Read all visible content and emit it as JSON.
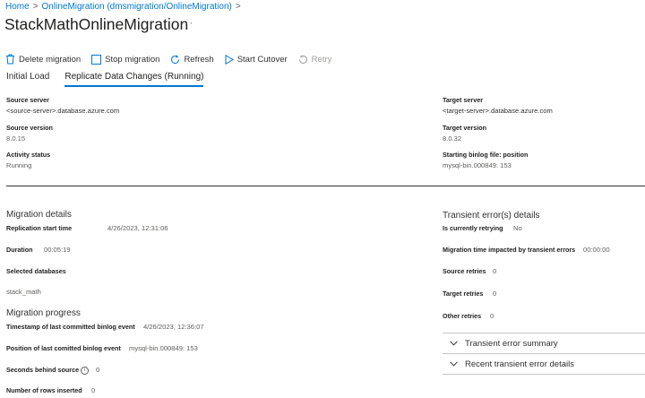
{
  "breadcrumb": {
    "home": "Home",
    "parent": "OnlineMigration (dmsmigration/OnlineMigration)",
    "sep": ">"
  },
  "page": {
    "title": "StackMathOnlineMigration",
    "more": "···"
  },
  "toolbar": {
    "delete_label": "Delete migration",
    "stop_label": "Stop migration",
    "refresh_label": "Refresh",
    "cutover_label": "Start Cutover",
    "retry_label": "Retry"
  },
  "tabs": [
    {
      "label": "Initial Load"
    },
    {
      "label": "Replicate Data Changes (Running)"
    }
  ],
  "source": {
    "server_label": "Source server",
    "server_value": "<source-server>.database.azure.com",
    "version_label": "Source version",
    "version_value": "8.0.15",
    "status_label": "Activity status",
    "status_value": "Running"
  },
  "target": {
    "server_label": "Target server",
    "server_value": "<target-server>.database.azure.com",
    "version_label": "Target version",
    "version_value": "8.0.32",
    "binlog_label": "Starting binlog file: position",
    "binlog_value": "mysql-bin.000849: 153"
  },
  "migration_details": {
    "heading": "Migration details",
    "start_label": "Replication start time",
    "start_value": "4/26/2023, 12:31:06",
    "duration_label": "Duration",
    "duration_value": "00:05:19",
    "databases_label": "Selected databases",
    "databases_value": "stack_math"
  },
  "migration_progress": {
    "heading": "Migration progress",
    "timestamp_label": "Timestamp of last committed binlog event",
    "timestamp_value": "4/26/2023, 12:36:07",
    "position_label": "Position of last comitted binlog event",
    "position_value": "mysql-bin.000849: 153",
    "behind_label": "Seconds behind source",
    "behind_value": "0",
    "rows_label": "Number of rows inserted",
    "rows_value": "0",
    "info_icon": "i"
  },
  "transient": {
    "heading": "Transient error(s) details",
    "retrying_label": "Is currently retrying",
    "retrying_value": "No",
    "impacted_label": "Migration time impacted by transient errors",
    "impacted_value": "00:00:00",
    "source_retries_label": "Source retries",
    "source_retries_value": "0",
    "target_retries_label": "Target retries",
    "target_retries_value": "0",
    "other_retries_label": "Other retries",
    "other_retries_value": "0",
    "summary_label": "Transient error summary",
    "recent_label": "Recent transient error details"
  },
  "colors": {
    "accent": "#0078d4",
    "text": "#323130",
    "disabled": "#a19f9d"
  }
}
